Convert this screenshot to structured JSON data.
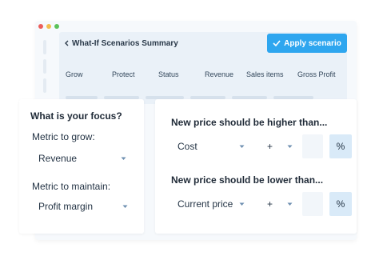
{
  "window": {
    "dots": [
      "red",
      "yellow",
      "green"
    ]
  },
  "summary": {
    "back_icon": "chevron-left-icon",
    "title": "What-If Scenarios Summary",
    "apply_label": "Apply scenario",
    "apply_icon": "checkmark-icon",
    "columns": [
      "Grow",
      "Protect",
      "Status",
      "Revenue",
      "Sales items",
      "Gross Profit"
    ]
  },
  "focus": {
    "title": "What is your focus?",
    "grow_label": "Metric to grow:",
    "grow_value": "Revenue",
    "maintain_label": "Metric to maintain:",
    "maintain_value": "Profit margin"
  },
  "price": {
    "higher": {
      "title": "New price should be higher than...",
      "base": "Cost",
      "operator": "+",
      "unit": "%"
    },
    "lower": {
      "title": "New price should be lower than...",
      "base": "Current price",
      "operator": "+",
      "unit": "%"
    }
  },
  "colors": {
    "accent": "#2ea6ef",
    "percent_box": "#d9eaf8"
  }
}
